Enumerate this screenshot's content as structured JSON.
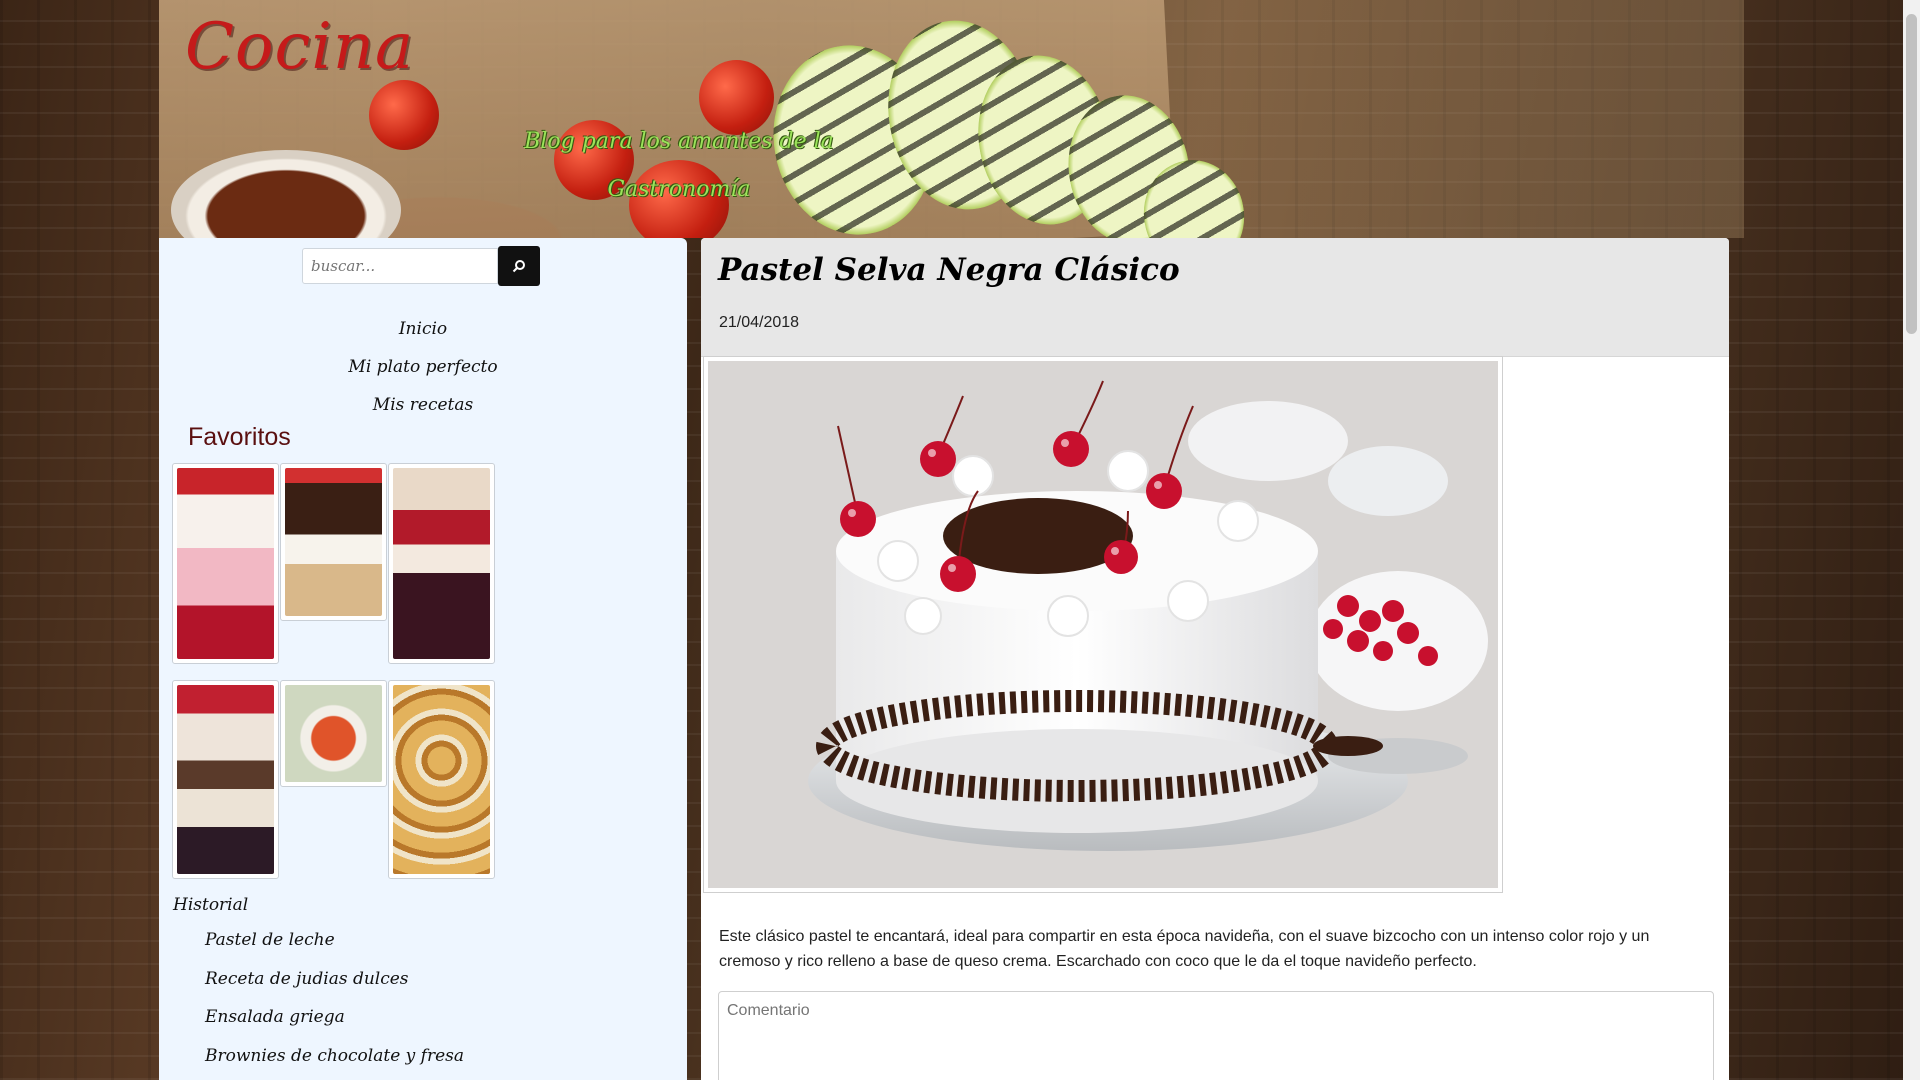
{
  "header": {
    "logo": "Cocina",
    "tagline": "Blog para los amantes de la Gastronomía"
  },
  "search": {
    "placeholder": "buscar...",
    "button_icon": "search-icon"
  },
  "nav": {
    "items": [
      "Inicio",
      "Mi plato perfecto",
      "Mis recetas"
    ]
  },
  "favorites": {
    "title": "Favoritos",
    "items": [
      {
        "icon": "strawberry-parfait-image"
      },
      {
        "icon": "chocolate-tart-image"
      },
      {
        "icon": "berry-trifle-image"
      },
      {
        "icon": "layered-dessert-image"
      },
      {
        "icon": "soup-bowls-image"
      },
      {
        "icon": "pretzel-pastries-image"
      }
    ]
  },
  "history": {
    "title": "Historial",
    "items": [
      "Pastel de leche",
      "Receta de judias dulces",
      "Ensalada griega",
      "Brownies de chocolate y fresa"
    ]
  },
  "post": {
    "title": "Pastel Selva Negra Clásico",
    "date": "21/04/2018",
    "image": "black-forest-cake-image",
    "body": "Este clásico pastel te encantará, ideal para compartir en esta época navideña, con el suave bizcocho con un intenso color rojo y un cremoso y rico relleno a base de queso crema. Escarchado con coco que le da el toque navideño perfecto.",
    "comment_placeholder": "Comentario"
  }
}
